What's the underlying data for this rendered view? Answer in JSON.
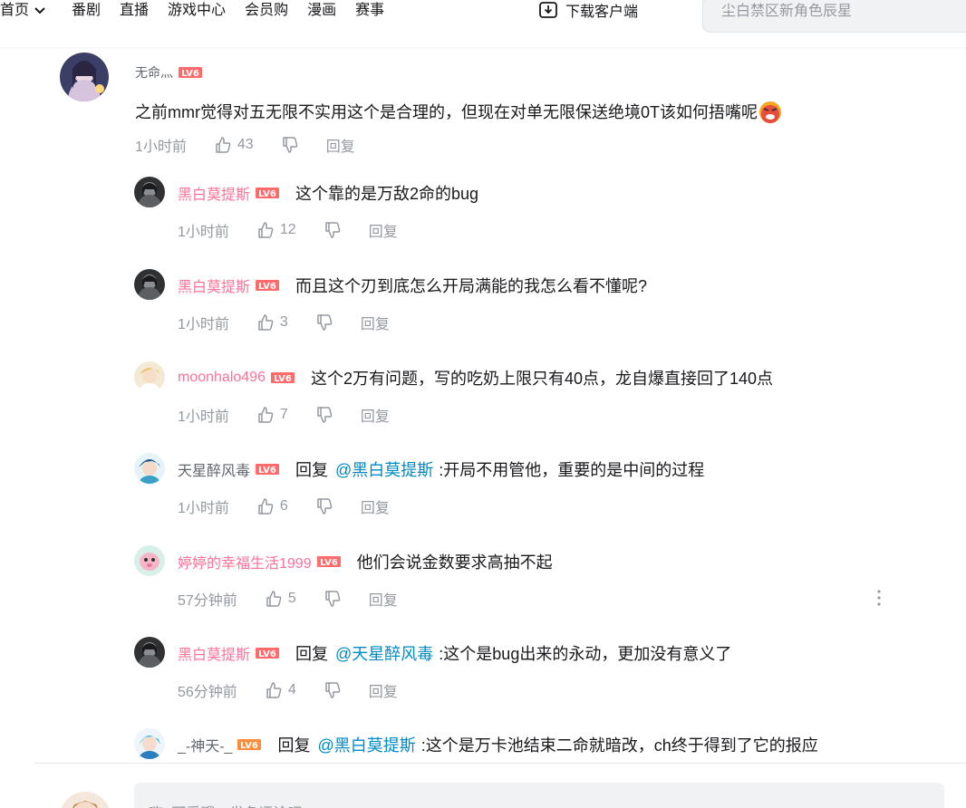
{
  "nav": {
    "items": [
      "首页",
      "番剧",
      "直播",
      "游戏中心",
      "会员购",
      "漫画",
      "赛事"
    ],
    "download": "下载客户端",
    "search_placeholder": "尘白禁区新角色辰星"
  },
  "level_badge": "LV6",
  "root": {
    "user": "无命灬",
    "text": "之前mmr觉得对五无限不实用这个是合理的，但现在对单无限保送绝境0T该如何捂嘴呢",
    "time": "1小时前",
    "likes": "43",
    "reply": "回复"
  },
  "replies": [
    {
      "user": "黑白莫提斯",
      "text": "这个靠的是万敌2命的bug",
      "time": "1小时前",
      "likes": "12",
      "reply": "回复"
    },
    {
      "user": "黑白莫提斯",
      "text": "而且这个刃到底怎么开局满能的我怎么看不懂呢?",
      "time": "1小时前",
      "likes": "3",
      "reply": "回复"
    },
    {
      "user": "moonhalo496",
      "text": "这个2万有问题，写的吃奶上限只有40点，龙自爆直接回了140点",
      "time": "1小时前",
      "likes": "7",
      "reply": "回复"
    },
    {
      "user": "天星醉风毒",
      "prefix": "回复",
      "mention": "@黑白莫提斯",
      "text": ":开局不用管他，重要的是中间的过程",
      "time": "1小时前",
      "likes": "6",
      "reply": "回复"
    },
    {
      "user": "婷婷的幸福生活1999",
      "text": "他们会说金数要求高抽不起",
      "time": "57分钟前",
      "likes": "5",
      "reply": "回复"
    },
    {
      "user": "黑白莫提斯",
      "prefix": "回复",
      "mention": "@天星醉风毒",
      "text": ":这个是bug出来的永动，更加没有意义了",
      "time": "56分钟前",
      "likes": "4",
      "reply": "回复"
    },
    {
      "user": "_-神天-_",
      "prefix": "回复",
      "mention": "@黑白莫提斯",
      "text": ":这个是万卡池结束二命就暗改，ch终于得到了它的报应"
    }
  ],
  "bottom_input_placeholder": "嗨~可爱哦，发条评论吧"
}
